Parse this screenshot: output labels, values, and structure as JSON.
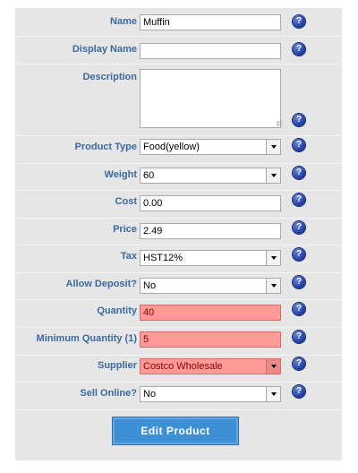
{
  "form": {
    "fields": [
      {
        "key": "name",
        "label": "Name",
        "value": "Muffin"
      },
      {
        "key": "display_name",
        "label": "Display Name",
        "value": ""
      },
      {
        "key": "description",
        "label": "Description",
        "value": ""
      },
      {
        "key": "product_type",
        "label": "Product Type",
        "value": "Food(yellow)"
      },
      {
        "key": "weight",
        "label": "Weight",
        "value": "60"
      },
      {
        "key": "cost",
        "label": "Cost",
        "value": "0.00"
      },
      {
        "key": "price",
        "label": "Price",
        "value": "2.49"
      },
      {
        "key": "tax",
        "label": "Tax",
        "value": "HST12%"
      },
      {
        "key": "allow_deposit",
        "label": "Allow Deposit?",
        "value": "No"
      },
      {
        "key": "quantity",
        "label": "Quantity",
        "value": "40"
      },
      {
        "key": "minimum_quantity",
        "label": "Minimum Quantity (1)",
        "value": "5"
      },
      {
        "key": "supplier",
        "label": "Supplier",
        "value": "Costco Wholesale"
      },
      {
        "key": "sell_online",
        "label": "Sell Online?",
        "value": "No"
      }
    ],
    "help_glyph": "?",
    "submit_label": "Edit Product"
  },
  "colors": {
    "label": "#3a6a9f",
    "panel": "#e6e6e6",
    "error_field": "#ff9a98",
    "button": "#3d8fd6",
    "help_icon": "#1c3a9c"
  },
  "icons": {
    "help": "help-icon",
    "dropdown": "chevron-down-icon"
  }
}
